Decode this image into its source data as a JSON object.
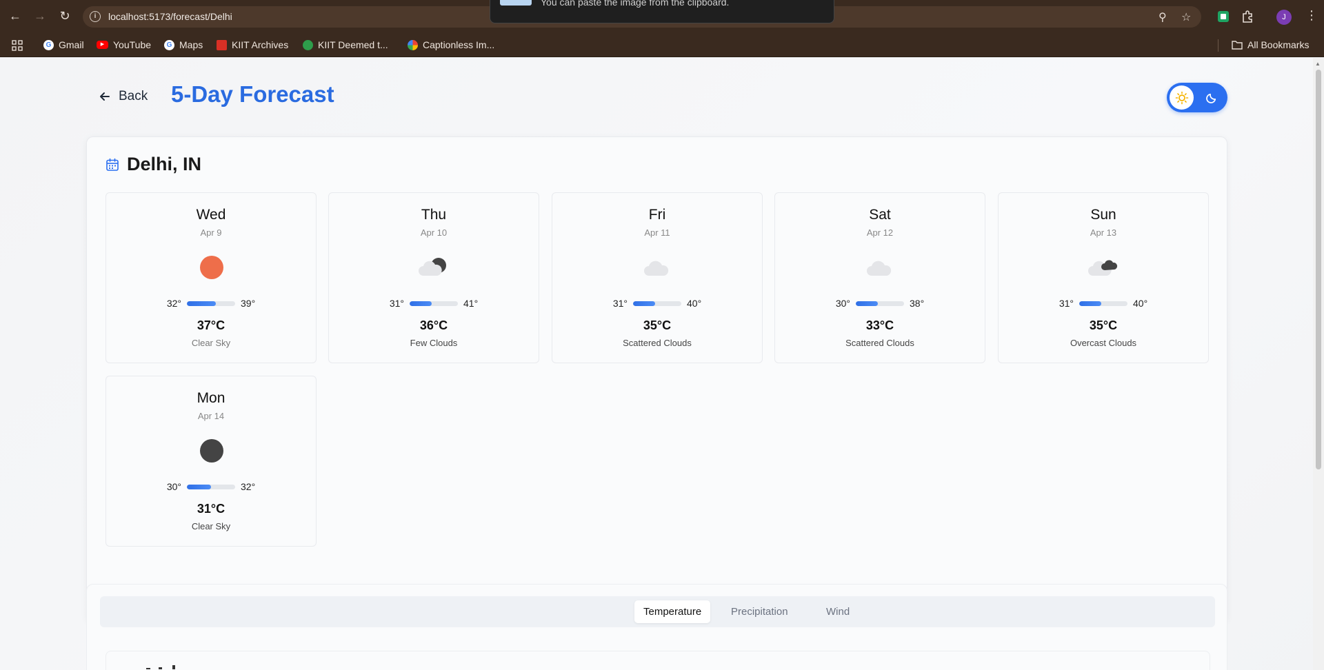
{
  "browser": {
    "url": "localhost:5173/forecast/Delhi",
    "toast_text": "You can paste the image from the clipboard.",
    "profile_initial": "J",
    "bookmarks": [
      {
        "label": "Gmail",
        "icon": "google-icon",
        "color": "#4285f4"
      },
      {
        "label": "YouTube",
        "icon": "youtube-icon",
        "color": "#ff0000"
      },
      {
        "label": "Maps",
        "icon": "google-icon",
        "color": "#4285f4"
      },
      {
        "label": "KIIT Archives",
        "icon": "kiit-icon",
        "color": "#d93025"
      },
      {
        "label": "KIIT Deemed t...",
        "icon": "kiit-leaf-icon",
        "color": "#2e9d4b"
      },
      {
        "label": "Captionless Im...",
        "icon": "photos-icon",
        "color": "#fbbc04"
      }
    ],
    "all_bookmarks_label": "All Bookmarks"
  },
  "header": {
    "back_label": "Back",
    "title": "5-Day Forecast",
    "theme": "light"
  },
  "location": {
    "city": "Delhi, IN"
  },
  "forecast": [
    {
      "day": "Wed",
      "date": "Apr 9",
      "icon": "clear-sky-icon",
      "min": "32°",
      "max": "39°",
      "range_fraction": 0.6,
      "temp": "37°C",
      "description": "Clear Sky",
      "icon_color": "#ee6e4a"
    },
    {
      "day": "Thu",
      "date": "Apr 10",
      "icon": "few-clouds-icon",
      "min": "31°",
      "max": "41°",
      "range_fraction": 0.45,
      "temp": "36°C",
      "description": "Few Clouds",
      "icon_color": "#444444"
    },
    {
      "day": "Fri",
      "date": "Apr 11",
      "icon": "scattered-clouds-icon",
      "min": "31°",
      "max": "40°",
      "range_fraction": 0.45,
      "temp": "35°C",
      "description": "Scattered Clouds",
      "icon_color": "#e4e5e8"
    },
    {
      "day": "Sat",
      "date": "Apr 12",
      "icon": "scattered-clouds-icon",
      "min": "30°",
      "max": "38°",
      "range_fraction": 0.45,
      "temp": "33°C",
      "description": "Scattered Clouds",
      "icon_color": "#e4e5e8"
    },
    {
      "day": "Sun",
      "date": "Apr 13",
      "icon": "overcast-clouds-icon",
      "min": "31°",
      "max": "40°",
      "range_fraction": 0.45,
      "temp": "35°C",
      "description": "Overcast Clouds",
      "icon_color": "#444444"
    },
    {
      "day": "Mon",
      "date": "Apr 14",
      "icon": "clear-sky-night-icon",
      "min": "30°",
      "max": "32°",
      "range_fraction": 0.5,
      "temp": "31°C",
      "description": "Clear Sky",
      "icon_color": "#444444"
    }
  ],
  "tabs": [
    {
      "label": "Temperature",
      "active": true
    },
    {
      "label": "Precipitation",
      "active": false
    },
    {
      "label": "Wind",
      "active": false
    }
  ]
}
